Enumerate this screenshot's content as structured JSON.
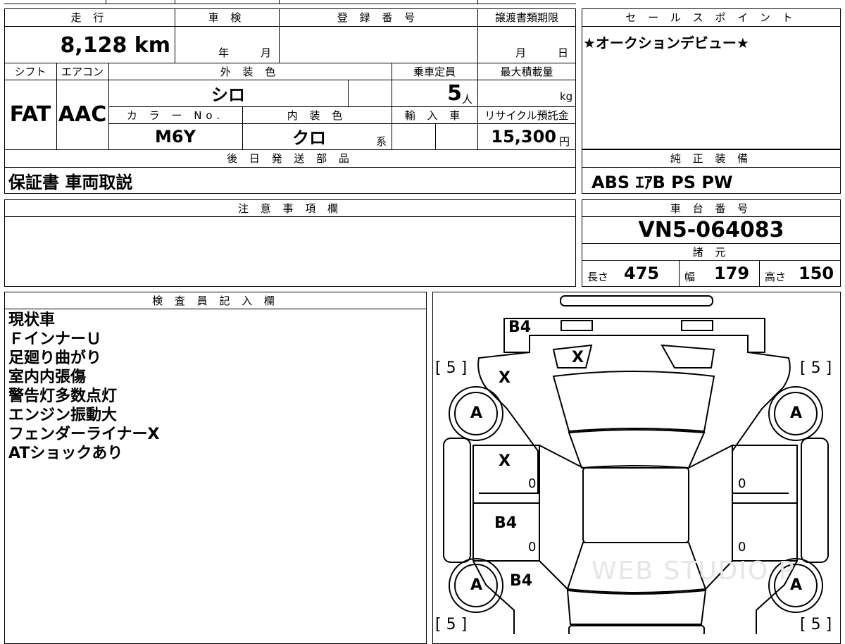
{
  "top_table": {
    "mileage_header": "走 行",
    "mileage_value": "8,128 km",
    "inspection_header": "車 検",
    "inspection_year": "年",
    "inspection_month": "月",
    "registration_header": "登 録 番 号",
    "transfer_deadline_header": "譲渡書類期限",
    "transfer_month": "月",
    "transfer_day": "日",
    "shift_header": "シフト",
    "ac_header": "エアコン",
    "exterior_color_header": "外 装 色",
    "capacity_header": "乗車定員",
    "max_load_header": "最大積載量",
    "shift_value": "FAT",
    "ac_value": "AAC",
    "exterior_color_value": "シロ",
    "capacity_value": "5",
    "capacity_unit": "人",
    "max_load_unit": "kg",
    "color_no_header": "カ ラ ー No.",
    "interior_color_header": "内 装 色",
    "import_header": "輸 入 車",
    "recycle_header": "リサイクル預託金",
    "color_no_value": "M6Y",
    "interior_color_value": "クロ",
    "interior_color_suffix": "系",
    "recycle_value": "15,300",
    "recycle_unit": "円",
    "later_parts_header": "後 日 発 送 部 品",
    "later_parts_value": "保証書 車両取説"
  },
  "sales_point": {
    "header": "セ ー ル ス ポ イ ン ト",
    "text": "★オークションデビュー★"
  },
  "genuine_equipment": {
    "header": "純 正 装 備",
    "value": "ABS ｴｱB PS PW"
  },
  "notes": {
    "header": "注 意 事 項 欄"
  },
  "chassis": {
    "header": "車 台 番 号",
    "value": "VN5-064083"
  },
  "specs": {
    "header": "諸 元",
    "length_label": "長さ",
    "length_value": "475",
    "width_label": "幅",
    "width_value": "179",
    "height_label": "高さ",
    "height_value": "150"
  },
  "inspector": {
    "header": "検 査 員 記 入 欄",
    "lines": "現状車\nＦインナーＵ\n足廻り曲がり\n室内内張傷\n警告灯多数点灯\nエンジン振動大\nフェンダーライナーX\nATショックあり"
  },
  "diagram": {
    "tire_left_front": "[ 5 ]",
    "tire_right_front": "[ 5 ]",
    "tire_left_rear": "[ 5 ]",
    "tire_right_rear": "[ 5 ]",
    "wheel_label": "A",
    "front_bumper": "B4",
    "hood_mark": "X",
    "left_fender": "X",
    "left_front_door": "X",
    "left_rear_door": "B4",
    "left_rear_fender": "B4",
    "door_zero": "0",
    "watermark": "WEB STUDIO P"
  }
}
